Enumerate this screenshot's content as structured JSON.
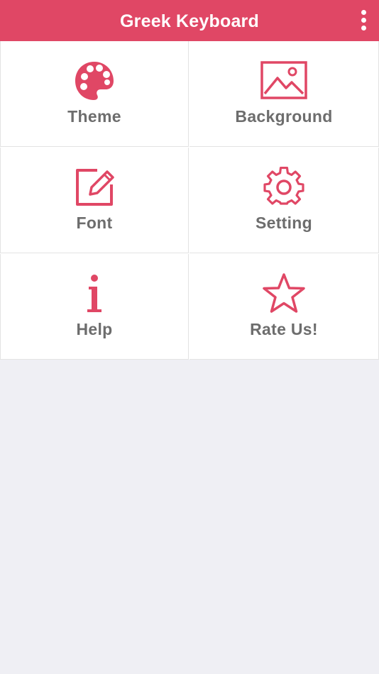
{
  "header": {
    "title": "Greek Keyboard",
    "menu_icon": "more-vert-icon"
  },
  "colors": {
    "accent": "#e04765",
    "label": "#6d6d6d",
    "background": "#efeff4"
  },
  "menu": [
    {
      "label": "Theme",
      "icon": "palette-icon"
    },
    {
      "label": "Background",
      "icon": "image-icon"
    },
    {
      "label": "Font",
      "icon": "edit-icon"
    },
    {
      "label": "Setting",
      "icon": "gear-icon"
    },
    {
      "label": "Help",
      "icon": "info-icon"
    },
    {
      "label": "Rate Us!",
      "icon": "star-icon"
    }
  ]
}
